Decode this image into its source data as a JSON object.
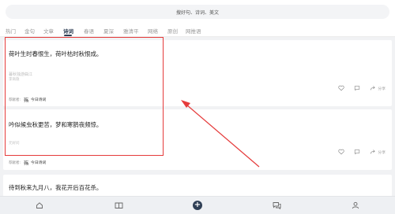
{
  "search": {
    "placeholder": "搜好句、诗词、美文"
  },
  "tabs": [
    {
      "label": "热门"
    },
    {
      "label": "金句"
    },
    {
      "label": "文章"
    },
    {
      "label": "诗词"
    },
    {
      "label": "春语"
    },
    {
      "label": "夏深"
    },
    {
      "label": "雅清平"
    },
    {
      "label": "网络"
    },
    {
      "label": "原创"
    },
    {
      "label": "网推语"
    }
  ],
  "active_tab": "诗词",
  "feed": [
    {
      "text": "荷叶生时春恨生，荷叶枯时秋恨成。",
      "source_title": "暮秋独游曲江",
      "source_author": "李商隐",
      "recommend_label": "荐献者:",
      "recommender": "今日诗词"
    },
    {
      "text": "吟似候虫秋更苦，梦和寒鹊夜频惊。",
      "source_author": "元好问",
      "recommend_label": "荐献者:",
      "recommender": "今日诗词"
    },
    {
      "text": "待到秋来九月八，我花开后百花杀。"
    }
  ],
  "actions": {
    "share_label": "分享"
  },
  "colors": {
    "accent": "#2f3f55",
    "annotation": "#e53b3b"
  }
}
